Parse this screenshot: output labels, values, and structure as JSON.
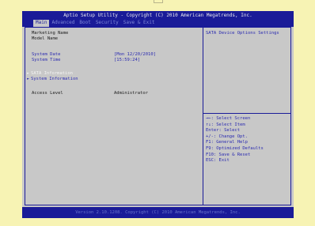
{
  "title": "Aptio Setup Utility - Copyright (C) 2010 American Megatrends, Inc.",
  "menu": [
    "Main",
    "Advanced",
    "Boot",
    "Security",
    "Save & Exit"
  ],
  "main": {
    "marketing_name_label": "Marketing Name",
    "model_name_label": "Model Name",
    "system_date_label": "System Date",
    "system_date_value": "[Mon 12/20/2010]",
    "system_time_label": "System Time",
    "system_time_value": "[15:59:24]",
    "sata_information": "SATA Information",
    "system_information": "System Information",
    "access_level_label": "Access Level",
    "access_level_value": "Administrator"
  },
  "help": {
    "title": "SATA Device Options Settings",
    "lines": [
      "→←: Select Screen",
      "↑↓: Select Item",
      "Enter: Select",
      "+/-: Change Opt.",
      "F1: General Help",
      "F9: Optimized Defaults",
      "F10: Save & Reset",
      "ESC: Exit"
    ]
  },
  "footer": "Version 2.10.1208. Copyright (C) 2010 American Megatrends, Inc.",
  "colors": {
    "background": "#f7f3b4",
    "bios_panel": "#c8c8c8",
    "bios_blue": "#1a1b98",
    "accent_text": "#2a2ab0"
  }
}
